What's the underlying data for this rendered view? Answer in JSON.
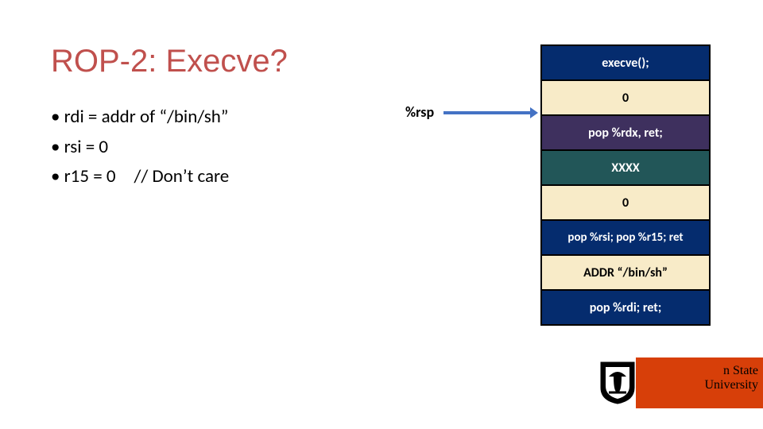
{
  "title": "ROP-2: Execve?",
  "bullets": {
    "b0": "rdi = addr of “/bin/sh”",
    "b1": "rsi = 0",
    "b2": "r15 = 0 // Don’t care"
  },
  "rsp_label": "%rsp",
  "stack": {
    "s0": "execve();",
    "s1": "0",
    "s2": "pop %rdx, ret;",
    "s3": "XXXX",
    "s4": "0",
    "s5": "pop %rsi; pop %r15; ret",
    "s6": "ADDR “/bin/sh”",
    "s7": "pop %rdi; ret;"
  },
  "logo": {
    "line1": "n State",
    "line2": "University"
  }
}
